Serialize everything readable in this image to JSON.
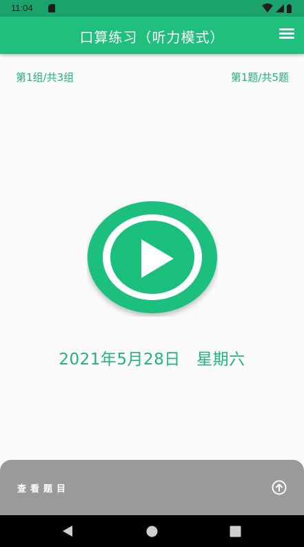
{
  "status_bar": {
    "time": "11:04",
    "icons": [
      "sd-card-icon",
      "wifi-icon",
      "signal-icon",
      "battery-icon"
    ]
  },
  "app_bar": {
    "title": "口算练习（听力模式）",
    "menu_icon": "hamburger-menu-icon"
  },
  "progress": {
    "group": "第1组/共3组",
    "question": "第1题/共5题"
  },
  "player": {
    "icon": "play-icon"
  },
  "date": {
    "text": "2021年5月28日   星期六"
  },
  "bottom_sheet": {
    "label": "查看题目",
    "icon": "arrow-up-circle-icon"
  },
  "navigation": {
    "icons": [
      "back-icon",
      "home-icon",
      "recent-apps-icon"
    ]
  },
  "colors": {
    "status_bar": "#1aa36c",
    "app_bar": "#21bf7e",
    "accent": "#1fb57a",
    "bottom_sheet": "#9a9a9a",
    "nav_bar": "#000000"
  }
}
